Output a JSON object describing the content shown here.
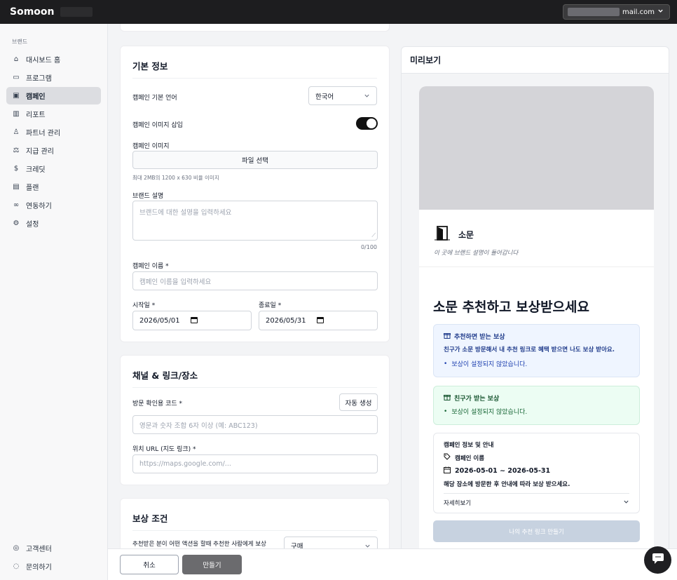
{
  "topbar": {
    "app_name": "Somoon",
    "account_email": "mail.com"
  },
  "sidebar": {
    "section_label": "브랜드",
    "items": [
      {
        "label": "대시보드 홈",
        "icon": "home-icon",
        "glyph": "⌂"
      },
      {
        "label": "프로그램",
        "icon": "calendar-icon",
        "glyph": "▭"
      },
      {
        "label": "캠페인",
        "icon": "calendar-icon",
        "glyph": "▣"
      },
      {
        "label": "리포트",
        "icon": "chart-icon",
        "glyph": "▥"
      },
      {
        "label": "파트너 관리",
        "icon": "users-icon",
        "glyph": "♙"
      },
      {
        "label": "지급 관리",
        "icon": "payout-icon",
        "glyph": "⚖"
      },
      {
        "label": "크레딧",
        "icon": "coin-icon",
        "glyph": "$"
      },
      {
        "label": "플랜",
        "icon": "card-icon",
        "glyph": "▤"
      },
      {
        "label": "연동하기",
        "icon": "link-icon",
        "glyph": "∞"
      },
      {
        "label": "설정",
        "icon": "gear-icon",
        "glyph": "⚙"
      }
    ],
    "bottom_items": [
      {
        "label": "고객센터",
        "icon": "support-icon",
        "glyph": "◎"
      },
      {
        "label": "문의하기",
        "icon": "chat-icon",
        "glyph": "◌"
      }
    ]
  },
  "basic_info": {
    "title": "기본 정보",
    "language_label": "캠페인 기본 언어",
    "language_value": "한국어",
    "image_insert_label": "캠페인 이미지 삽입",
    "image_insert_on": true,
    "image_label": "캠페인 이미지",
    "file_button": "파일 선택",
    "image_hint": "최대 2MB의 1200 x 630 비율 이미지",
    "brand_desc_label": "브랜드 설명",
    "brand_desc_placeholder": "브랜드에 대한 설명을 입력하세요",
    "brand_desc_count": "0/100",
    "campaign_name_label": "캠페인 이름 *",
    "campaign_name_placeholder": "캠페인 이름을 입력하세요",
    "start_label": "시작일 *",
    "start_value": "2026/05/01",
    "end_label": "종료일 *",
    "end_value": "2026/05/31"
  },
  "channel": {
    "title": "채널 & 링크/장소",
    "code_label": "방문 확인용 코드 *",
    "auto_button": "자동 생성",
    "code_placeholder": "영문과 숫자 조합 6자 이상 (예: ABC123)",
    "url_label": "위치 URL (지도 링크) *",
    "url_placeholder": "https://maps.google.com/..."
  },
  "reward": {
    "title": "보상 조건",
    "condition_label": "추천받은 분이 어떤 액션을 할때 추천한 사람에게 보상",
    "condition_value": "구매"
  },
  "preview": {
    "title": "미리보기",
    "brand_name": "소문",
    "brand_desc": "이 곳에 브랜드 설명이 들어갑니다",
    "headline": "소문 추천하고 보상받으세요",
    "referrer_title": "추천하면 받는 보상",
    "referrer_desc": "친구가 소문 방문해서 내 추천 링크로 혜택 받으면 나도 보상 받아요.",
    "referrer_bullet": "보상이 설정되지 않았습니다.",
    "friend_title": "친구가 받는 보상",
    "friend_bullet": "보상이 설정되지 않았습니다.",
    "info_title": "캠페인 정보 및 안내",
    "info_name": "캠페인 이름",
    "info_dates": "2026-05-01 ~ 2026-05-31",
    "info_note": "해당 장소에 방문한 후 안내에 따라 보상 받으세요.",
    "details_label": "자세히보기",
    "cta_label": "나의 추천 링크 만들기"
  },
  "footer": {
    "cancel": "취소",
    "create": "만들기"
  },
  "colors": {
    "blue_box": "#eff5ff",
    "green_box": "#ecfdf3",
    "cta": "#c7d2e0"
  }
}
